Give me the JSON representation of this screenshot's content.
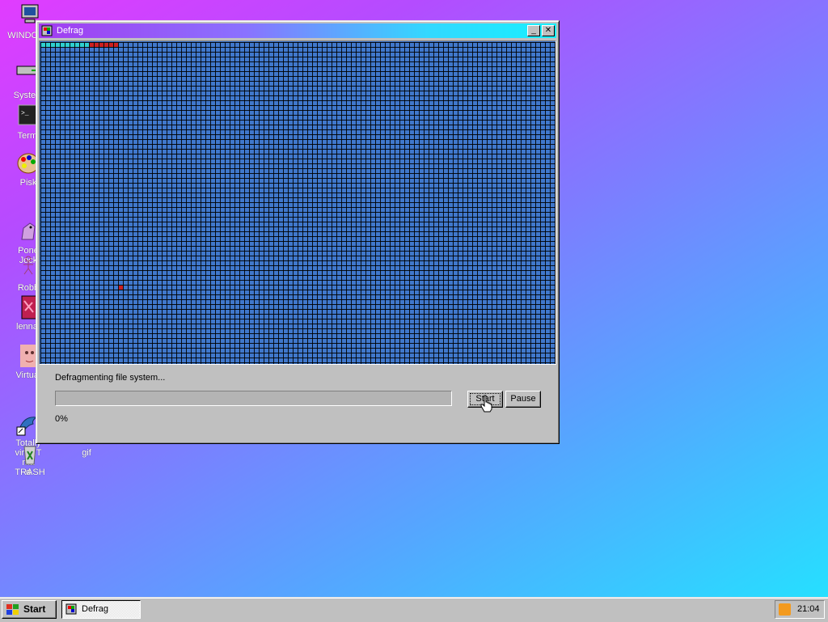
{
  "desktop": {
    "icons": [
      {
        "label": "WINDOWS",
        "icon": "computer-icon"
      },
      {
        "label": "System",
        "icon": "drive-icon"
      },
      {
        "label": "Termi",
        "icon": "terminal-icon"
      },
      {
        "label": "Pisk",
        "icon": "palette-icon"
      },
      {
        "label": "Pone\nJock",
        "icon": "pony-icon"
      },
      {
        "label": "Robb",
        "icon": "stick-figure-icon"
      },
      {
        "label": "lenna.",
        "icon": "image-icon"
      },
      {
        "label": "Virtual",
        "icon": "face-icon"
      },
      {
        "label": "Totally\nvirus.T\nma\nd",
        "icon": "dolphin-icon"
      },
      {
        "label": "TRASH",
        "icon": "trash-icon"
      },
      {
        "label": "gif",
        "icon": "gif-file-icon"
      }
    ]
  },
  "window": {
    "title": "Defrag",
    "status_text": "Defragmenting file system...",
    "progress_value": 0,
    "percent_text": "0%",
    "start_label": "Start",
    "pause_label": "Pause",
    "minimize_glyph": "_",
    "close_glyph": "✕"
  },
  "diskmap": {
    "legend_colors": {
      "free": "#4078cc",
      "done": "#2fd0d0",
      "fragmented": "#cc2020"
    },
    "done_count": 10,
    "fragmented_top_count": 6,
    "fragmented_misc_count": 1
  },
  "taskbar": {
    "start_label": "Start",
    "tasks": [
      {
        "label": "Defrag"
      }
    ],
    "clock": "21:04"
  }
}
